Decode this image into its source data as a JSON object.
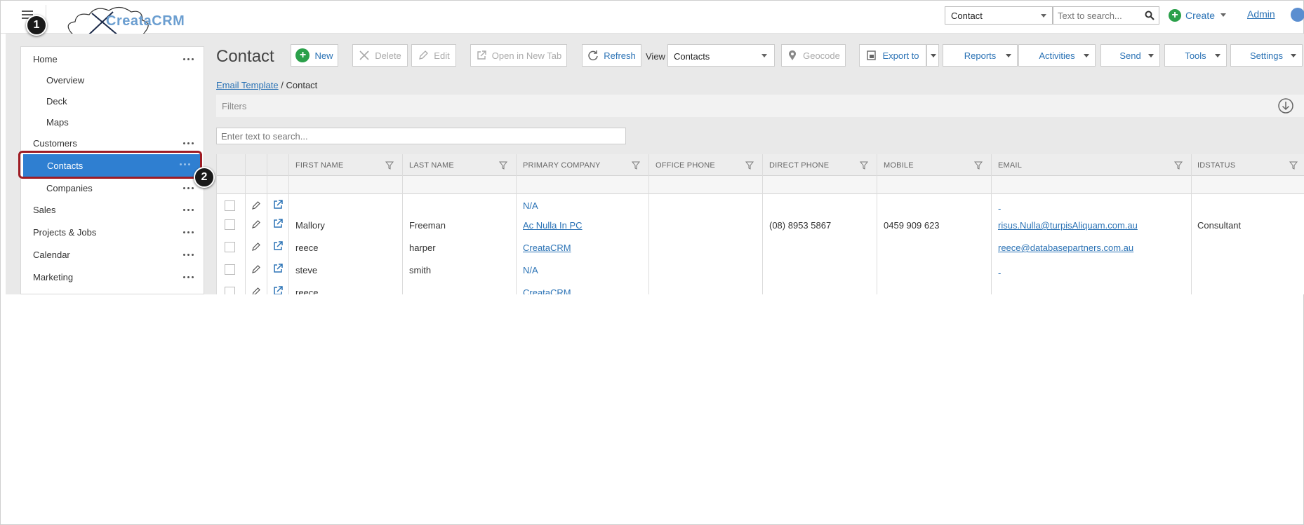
{
  "topbar": {
    "brand": "CreataCRM",
    "entity_select": "Contact",
    "search_placeholder": "Text to search...",
    "create_label": "Create",
    "admin_label": "Admin"
  },
  "sidebar": {
    "items": [
      {
        "label": "Home",
        "level": 1,
        "has_menu": true
      },
      {
        "label": "Overview",
        "level": 2,
        "has_menu": false
      },
      {
        "label": "Deck",
        "level": 2,
        "has_menu": false
      },
      {
        "label": "Maps",
        "level": 2,
        "has_menu": false
      },
      {
        "label": "Customers",
        "level": 1,
        "has_menu": true
      },
      {
        "label": "Contacts",
        "level": 2,
        "has_menu": true,
        "active": true
      },
      {
        "label": "Companies",
        "level": 2,
        "has_menu": true
      },
      {
        "label": "Sales",
        "level": 1,
        "has_menu": true
      },
      {
        "label": "Projects & Jobs",
        "level": 1,
        "has_menu": true
      },
      {
        "label": "Calendar",
        "level": 1,
        "has_menu": true
      },
      {
        "label": "Marketing",
        "level": 1,
        "has_menu": true
      }
    ]
  },
  "callouts": {
    "one": "1",
    "two": "2"
  },
  "main": {
    "title": "Contact",
    "toolbar": {
      "new": "New",
      "delete": "Delete",
      "edit": "Edit",
      "open_new_tab": "Open in New Tab",
      "refresh": "Refresh",
      "view_label": "View",
      "view_value": "Contacts",
      "geocode": "Geocode",
      "export": "Export to",
      "reports": "Reports",
      "activities": "Activities",
      "send": "Send",
      "tools": "Tools",
      "settings": "Settings"
    },
    "breadcrumb": {
      "link": "Email Template",
      "sep": " / ",
      "current": "Contact"
    },
    "filters_label": "Filters",
    "grid_search_placeholder": "Enter text to search...",
    "columns": [
      "FIRST NAME",
      "LAST NAME",
      "PRIMARY COMPANY",
      "OFFICE PHONE",
      "DIRECT PHONE",
      "MOBILE",
      "EMAIL",
      "IDSTATUS"
    ],
    "rows": [
      {
        "first": "",
        "last": "",
        "company": "N/A",
        "office": "",
        "direct": "",
        "mobile": "",
        "email": "-",
        "status": ""
      },
      {
        "first": "Mallory",
        "last": "Freeman",
        "company": "Ac Nulla In PC",
        "office": "",
        "direct": "(08) 8953 5867",
        "mobile": "0459 909 623",
        "email": "risus.Nulla@turpisAliquam.com.au",
        "status": "Consultant"
      },
      {
        "first": "reece",
        "last": "harper",
        "company": "CreataCRM",
        "office": "",
        "direct": "",
        "mobile": "",
        "email": "reece@databasepartners.com.au",
        "status": ""
      },
      {
        "first": "steve",
        "last": "smith",
        "company": "N/A",
        "office": "",
        "direct": "",
        "mobile": "",
        "email": "-",
        "status": ""
      },
      {
        "first": "reece",
        "last": "",
        "company": "CreataCRM",
        "office": "",
        "direct": "",
        "mobile": "",
        "email": "",
        "status": ""
      }
    ]
  },
  "colors": {
    "accent": "#2a72b5",
    "active_nav": "#2f7fd1",
    "highlight": "#9e1c24",
    "create_green": "#2aa04a"
  }
}
